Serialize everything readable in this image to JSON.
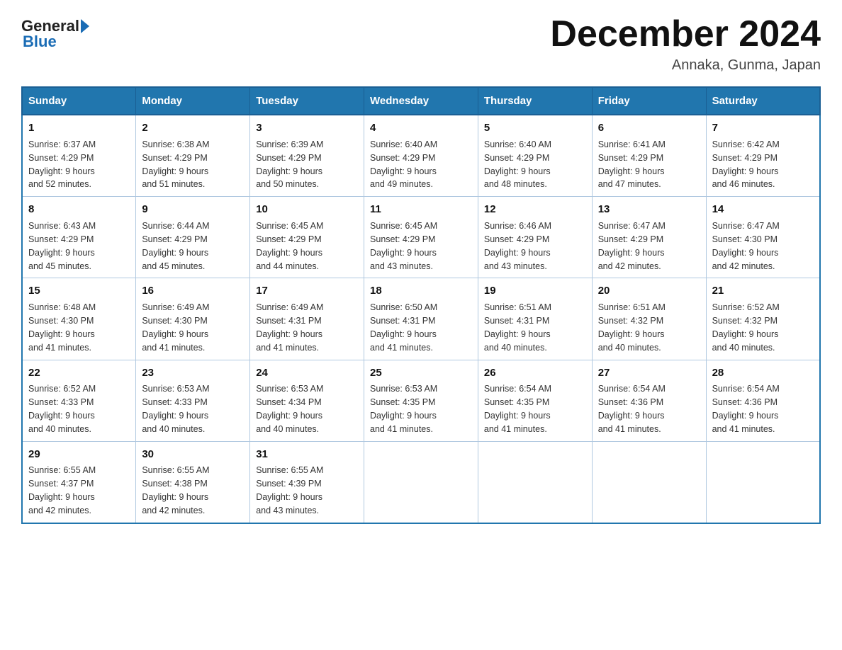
{
  "header": {
    "title": "December 2024",
    "location": "Annaka, Gunma, Japan",
    "logo_general": "General",
    "logo_blue": "Blue"
  },
  "days_of_week": [
    "Sunday",
    "Monday",
    "Tuesday",
    "Wednesday",
    "Thursday",
    "Friday",
    "Saturday"
  ],
  "weeks": [
    [
      {
        "day": "1",
        "sunrise": "6:37 AM",
        "sunset": "4:29 PM",
        "daylight": "9 hours and 52 minutes."
      },
      {
        "day": "2",
        "sunrise": "6:38 AM",
        "sunset": "4:29 PM",
        "daylight": "9 hours and 51 minutes."
      },
      {
        "day": "3",
        "sunrise": "6:39 AM",
        "sunset": "4:29 PM",
        "daylight": "9 hours and 50 minutes."
      },
      {
        "day": "4",
        "sunrise": "6:40 AM",
        "sunset": "4:29 PM",
        "daylight": "9 hours and 49 minutes."
      },
      {
        "day": "5",
        "sunrise": "6:40 AM",
        "sunset": "4:29 PM",
        "daylight": "9 hours and 48 minutes."
      },
      {
        "day": "6",
        "sunrise": "6:41 AM",
        "sunset": "4:29 PM",
        "daylight": "9 hours and 47 minutes."
      },
      {
        "day": "7",
        "sunrise": "6:42 AM",
        "sunset": "4:29 PM",
        "daylight": "9 hours and 46 minutes."
      }
    ],
    [
      {
        "day": "8",
        "sunrise": "6:43 AM",
        "sunset": "4:29 PM",
        "daylight": "9 hours and 45 minutes."
      },
      {
        "day": "9",
        "sunrise": "6:44 AM",
        "sunset": "4:29 PM",
        "daylight": "9 hours and 45 minutes."
      },
      {
        "day": "10",
        "sunrise": "6:45 AM",
        "sunset": "4:29 PM",
        "daylight": "9 hours and 44 minutes."
      },
      {
        "day": "11",
        "sunrise": "6:45 AM",
        "sunset": "4:29 PM",
        "daylight": "9 hours and 43 minutes."
      },
      {
        "day": "12",
        "sunrise": "6:46 AM",
        "sunset": "4:29 PM",
        "daylight": "9 hours and 43 minutes."
      },
      {
        "day": "13",
        "sunrise": "6:47 AM",
        "sunset": "4:29 PM",
        "daylight": "9 hours and 42 minutes."
      },
      {
        "day": "14",
        "sunrise": "6:47 AM",
        "sunset": "4:30 PM",
        "daylight": "9 hours and 42 minutes."
      }
    ],
    [
      {
        "day": "15",
        "sunrise": "6:48 AM",
        "sunset": "4:30 PM",
        "daylight": "9 hours and 41 minutes."
      },
      {
        "day": "16",
        "sunrise": "6:49 AM",
        "sunset": "4:30 PM",
        "daylight": "9 hours and 41 minutes."
      },
      {
        "day": "17",
        "sunrise": "6:49 AM",
        "sunset": "4:31 PM",
        "daylight": "9 hours and 41 minutes."
      },
      {
        "day": "18",
        "sunrise": "6:50 AM",
        "sunset": "4:31 PM",
        "daylight": "9 hours and 41 minutes."
      },
      {
        "day": "19",
        "sunrise": "6:51 AM",
        "sunset": "4:31 PM",
        "daylight": "9 hours and 40 minutes."
      },
      {
        "day": "20",
        "sunrise": "6:51 AM",
        "sunset": "4:32 PM",
        "daylight": "9 hours and 40 minutes."
      },
      {
        "day": "21",
        "sunrise": "6:52 AM",
        "sunset": "4:32 PM",
        "daylight": "9 hours and 40 minutes."
      }
    ],
    [
      {
        "day": "22",
        "sunrise": "6:52 AM",
        "sunset": "4:33 PM",
        "daylight": "9 hours and 40 minutes."
      },
      {
        "day": "23",
        "sunrise": "6:53 AM",
        "sunset": "4:33 PM",
        "daylight": "9 hours and 40 minutes."
      },
      {
        "day": "24",
        "sunrise": "6:53 AM",
        "sunset": "4:34 PM",
        "daylight": "9 hours and 40 minutes."
      },
      {
        "day": "25",
        "sunrise": "6:53 AM",
        "sunset": "4:35 PM",
        "daylight": "9 hours and 41 minutes."
      },
      {
        "day": "26",
        "sunrise": "6:54 AM",
        "sunset": "4:35 PM",
        "daylight": "9 hours and 41 minutes."
      },
      {
        "day": "27",
        "sunrise": "6:54 AM",
        "sunset": "4:36 PM",
        "daylight": "9 hours and 41 minutes."
      },
      {
        "day": "28",
        "sunrise": "6:54 AM",
        "sunset": "4:36 PM",
        "daylight": "9 hours and 41 minutes."
      }
    ],
    [
      {
        "day": "29",
        "sunrise": "6:55 AM",
        "sunset": "4:37 PM",
        "daylight": "9 hours and 42 minutes."
      },
      {
        "day": "30",
        "sunrise": "6:55 AM",
        "sunset": "4:38 PM",
        "daylight": "9 hours and 42 minutes."
      },
      {
        "day": "31",
        "sunrise": "6:55 AM",
        "sunset": "4:39 PM",
        "daylight": "9 hours and 43 minutes."
      },
      null,
      null,
      null,
      null
    ]
  ],
  "labels": {
    "sunrise": "Sunrise:",
    "sunset": "Sunset:",
    "daylight": "Daylight:"
  }
}
